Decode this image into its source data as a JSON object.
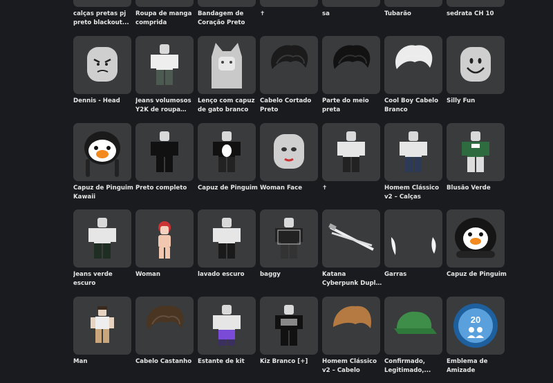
{
  "rows": [
    {
      "items": [
        {
          "name": "calças pretas pj preto blackout...",
          "icon": "avatar-black-pants-icon"
        },
        {
          "name": "Roupa de manga comprida",
          "icon": "avatar-long-sleeve-icon"
        },
        {
          "name": "Bandagem de Coração Preto",
          "icon": "black-heart-bandage-icon"
        },
        {
          "name": "✝",
          "icon": "cross-icon"
        },
        {
          "name": "sa",
          "icon": "item-sa-icon"
        },
        {
          "name": "Tubarão",
          "icon": "shark-icon"
        },
        {
          "name": "sedrata CH 10",
          "icon": "item-sedrata-icon"
        }
      ]
    },
    {
      "items": [
        {
          "name": "Dennis - Head",
          "icon": "angry-head-icon"
        },
        {
          "name": "Jeans volumosos Y2K de roupa de...",
          "icon": "avatar-baggy-jeans-icon"
        },
        {
          "name": "Lenço com capuz de gato branco",
          "icon": "white-cat-hood-icon"
        },
        {
          "name": "Cabelo Cortado Preto",
          "icon": "black-short-hair-icon"
        },
        {
          "name": "Parte do meio preta",
          "icon": "black-middle-part-hair-icon"
        },
        {
          "name": "Cool Boy Cabelo Branco",
          "icon": "white-hair-icon"
        },
        {
          "name": "Silly Fun",
          "icon": "smiling-head-icon"
        }
      ]
    },
    {
      "items": [
        {
          "name": "Capuz de Pinguim Kawaii",
          "icon": "penguin-hood-kawaii-icon"
        },
        {
          "name": "Preto completo",
          "icon": "avatar-all-black-icon"
        },
        {
          "name": "Capuz de Pinguim",
          "icon": "avatar-penguin-shirt-icon"
        },
        {
          "name": "Woman Face",
          "icon": "woman-face-icon"
        },
        {
          "name": "✝",
          "icon": "avatar-cross-pants-icon"
        },
        {
          "name": "Homem Clássico v2 – Calças",
          "icon": "avatar-classic-pants-icon"
        },
        {
          "name": "Blusão Verde",
          "icon": "avatar-green-jacket-icon"
        }
      ]
    },
    {
      "items": [
        {
          "name": "Jeans verde escuro",
          "icon": "avatar-dark-green-jeans-icon"
        },
        {
          "name": "Woman",
          "icon": "woman-avatar-icon"
        },
        {
          "name": "lavado escuro",
          "icon": "avatar-dark-wash-icon"
        },
        {
          "name": "baggy",
          "icon": "avatar-baggy-icon"
        },
        {
          "name": "Katana Cyberpunk Dupla Branca...",
          "icon": "white-katana-icon"
        },
        {
          "name": "Garras",
          "icon": "claws-icon"
        },
        {
          "name": "Capuz de Pinguim",
          "icon": "penguin-hood-icon"
        }
      ]
    },
    {
      "items": [
        {
          "name": "Man",
          "icon": "man-avatar-icon"
        },
        {
          "name": "Cabelo Castanho",
          "icon": "brown-hair-icon"
        },
        {
          "name": "Estante de kit",
          "icon": "avatar-kit-stand-icon"
        },
        {
          "name": "Kiz Branco [+]",
          "icon": "avatar-kiz-white-icon"
        },
        {
          "name": "Homem Clássico v2 – Cabelo",
          "icon": "classic-hair-icon"
        },
        {
          "name": "Confirmado, Legitimado,...",
          "icon": "green-cap-icon"
        },
        {
          "name": "Emblema de Amizade",
          "icon": "friendship-badge-icon"
        }
      ]
    }
  ],
  "badge_number": "20"
}
